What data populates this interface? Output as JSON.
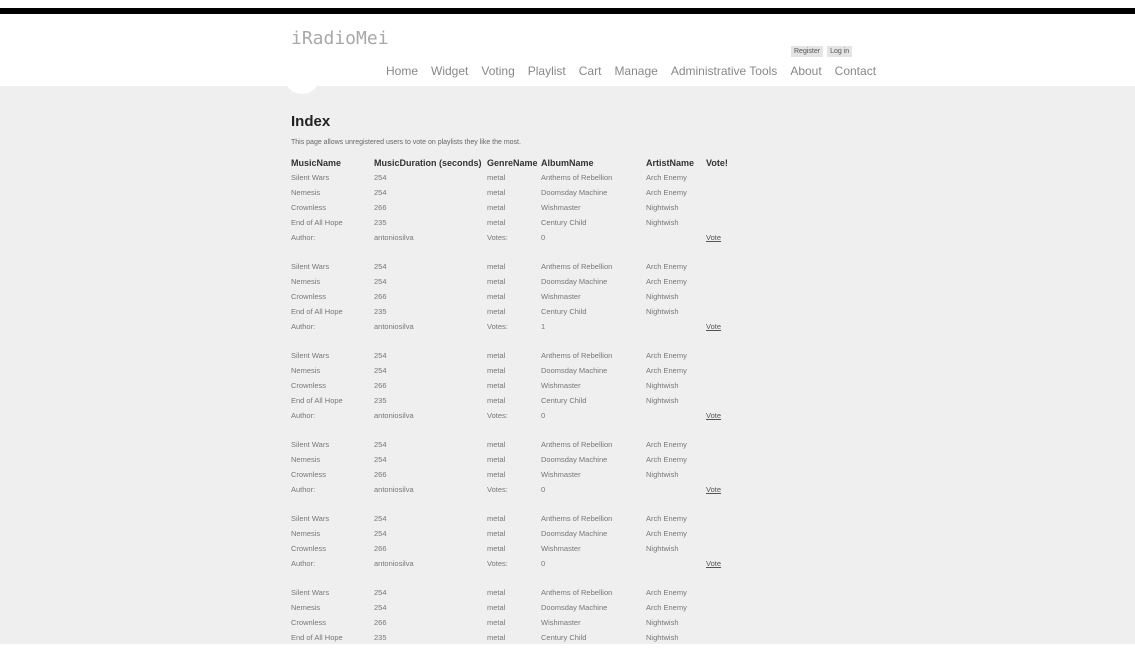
{
  "site": {
    "title": "iRadioMei",
    "register_label": "Register",
    "login_label": "Log in",
    "nav": [
      "Home",
      "Widget",
      "Voting",
      "Playlist",
      "Cart",
      "Manage",
      "Administrative Tools",
      "About",
      "Contact"
    ]
  },
  "page": {
    "title": "Index",
    "intro": "This page allows unregistered users to vote on playlists they like the most."
  },
  "table": {
    "headers": [
      "MusicName",
      "MusicDuration (seconds)",
      "GenreName",
      "AlbumName",
      "ArtistName",
      "Vote!"
    ],
    "author_label": "Author:",
    "votes_label": "Votes:",
    "vote_link": "Vote",
    "playlists": [
      {
        "songs": [
          [
            "Silent Wars",
            "254",
            "metal",
            "Anthems of Rebellion",
            "Arch Enemy"
          ],
          [
            "Nemesis",
            "254",
            "metal",
            "Doomsday Machine",
            "Arch Enemy"
          ],
          [
            "Crownless",
            "266",
            "metal",
            "Wishmaster",
            "Nightwish"
          ],
          [
            "End of All Hope",
            "235",
            "metal",
            "Century Child",
            "Nightwish"
          ]
        ],
        "author": "antoniosilva",
        "votes": "0"
      },
      {
        "songs": [
          [
            "Silent Wars",
            "254",
            "metal",
            "Anthems of Rebellion",
            "Arch Enemy"
          ],
          [
            "Nemesis",
            "254",
            "metal",
            "Doomsday Machine",
            "Arch Enemy"
          ],
          [
            "Crownless",
            "266",
            "metal",
            "Wishmaster",
            "Nightwish"
          ],
          [
            "End of All Hope",
            "235",
            "metal",
            "Century Child",
            "Nightwish"
          ]
        ],
        "author": "antoniosilva",
        "votes": "1"
      },
      {
        "songs": [
          [
            "Silent Wars",
            "254",
            "metal",
            "Anthems of Rebellion",
            "Arch Enemy"
          ],
          [
            "Nemesis",
            "254",
            "metal",
            "Doomsday Machine",
            "Arch Enemy"
          ],
          [
            "Crownless",
            "266",
            "metal",
            "Wishmaster",
            "Nightwish"
          ],
          [
            "End of All Hope",
            "235",
            "metal",
            "Century Child",
            "Nightwish"
          ]
        ],
        "author": "antoniosilva",
        "votes": "0"
      },
      {
        "songs": [
          [
            "Silent Wars",
            "254",
            "metal",
            "Anthems of Rebellion",
            "Arch Enemy"
          ],
          [
            "Nemesis",
            "254",
            "metal",
            "Doomsday Machine",
            "Arch Enemy"
          ],
          [
            "Crownless",
            "266",
            "metal",
            "Wishmaster",
            "Nightwish"
          ]
        ],
        "author": "antoniosilva",
        "votes": "0"
      },
      {
        "songs": [
          [
            "Silent Wars",
            "254",
            "metal",
            "Anthems of Rebellion",
            "Arch Enemy"
          ],
          [
            "Nemesis",
            "254",
            "metal",
            "Doomsday Machine",
            "Arch Enemy"
          ],
          [
            "Crownless",
            "266",
            "metal",
            "Wishmaster",
            "Nightwish"
          ]
        ],
        "author": "antoniosilva",
        "votes": "0"
      },
      {
        "songs": [
          [
            "Silent Wars",
            "254",
            "metal",
            "Anthems of Rebellion",
            "Arch Enemy"
          ],
          [
            "Nemesis",
            "254",
            "metal",
            "Doomsday Machine",
            "Arch Enemy"
          ],
          [
            "Crownless",
            "266",
            "metal",
            "Wishmaster",
            "Nightwish"
          ],
          [
            "End of All Hope",
            "235",
            "metal",
            "Century Child",
            "Nightwish"
          ]
        ]
      }
    ]
  }
}
